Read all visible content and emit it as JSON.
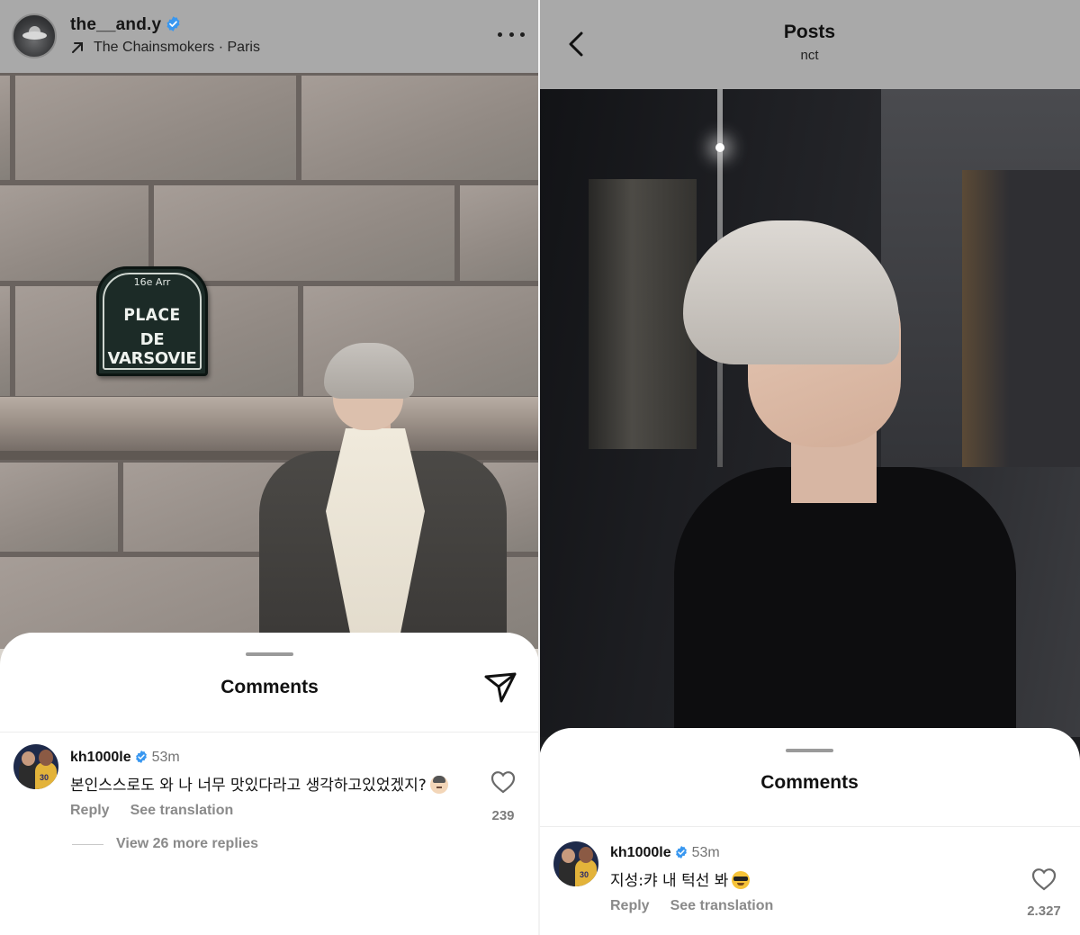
{
  "left": {
    "header": {
      "username": "the__and.y",
      "subtitle": "The Chainsmokers · Paris"
    },
    "photo": {
      "sign_arrondissement": "16e Arr",
      "sign_line1": "PLACE",
      "sign_line2": "DE VARSOVIE"
    },
    "sheet": {
      "title": "Comments",
      "comment": {
        "username": "kh1000le",
        "time": "53m",
        "text": "본인스스로도 와 나 너무 맛있다라고 생각하고있었겠지?",
        "reply_label": "Reply",
        "translation_label": "See translation",
        "likes": "239"
      },
      "view_more": "View 26 more replies"
    }
  },
  "right": {
    "header": {
      "title": "Posts",
      "subtitle": "nct"
    },
    "sheet": {
      "title": "Comments",
      "comment": {
        "username": "kh1000le",
        "time": "53m",
        "text": "지성:캬 내 턱선 봐",
        "reply_label": "Reply",
        "translation_label": "See translation",
        "likes": "2.327"
      }
    }
  },
  "colors": {
    "header_bg": "#a9a9a9",
    "verified_blue": "#3897f0",
    "muted_text": "#8a8a8a"
  },
  "icons": [
    "ufo-avatar-icon",
    "verified-icon",
    "arrow-up-right-icon",
    "more-icon",
    "send-icon",
    "heart-icon",
    "back-icon",
    "thinking-emoji-icon",
    "sunglasses-emoji-icon"
  ]
}
